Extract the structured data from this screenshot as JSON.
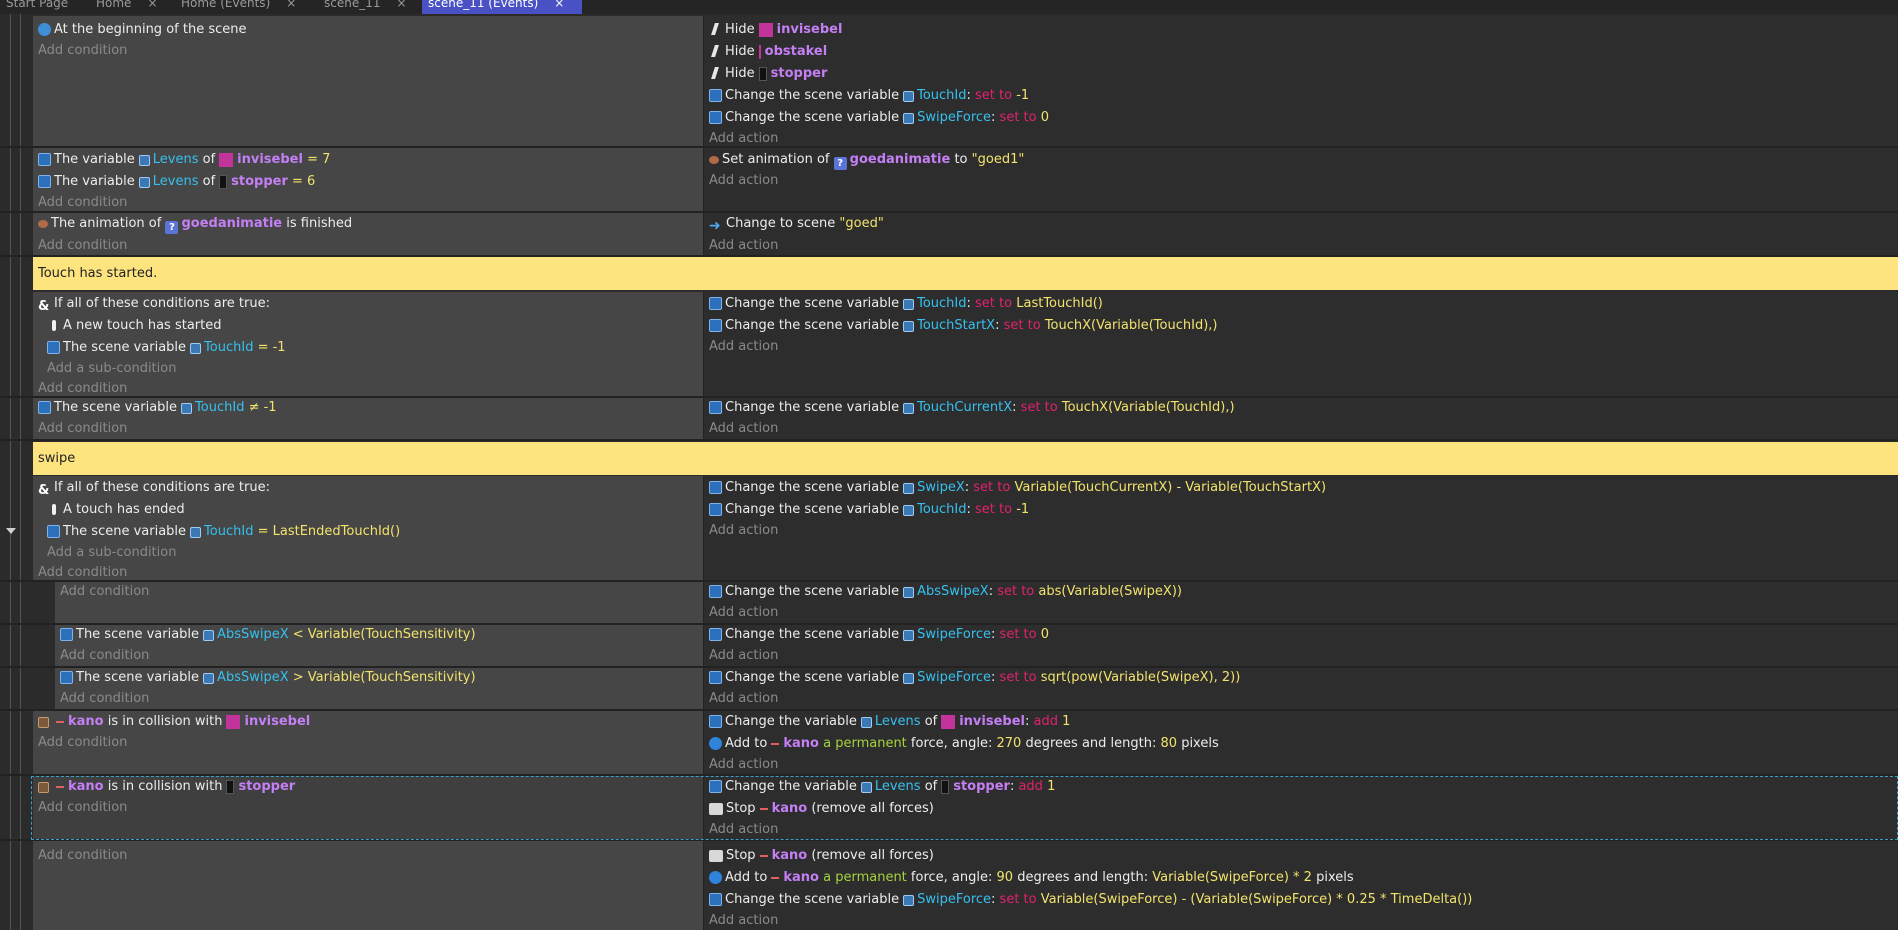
{
  "tabs": [
    {
      "label": "Start Page",
      "closable": false
    },
    {
      "label": "Home",
      "closable": true
    },
    {
      "label": "Home (Events)",
      "closable": true
    },
    {
      "label": "scene_11",
      "closable": true
    },
    {
      "label": "scene_11 (Events)",
      "closable": true,
      "active": true
    }
  ],
  "labels": {
    "add_condition": "Add condition",
    "add_action": "Add action",
    "add_subcondition": "Add a sub-condition"
  },
  "events": {
    "e1": {
      "cond": "At the beginning of the scene",
      "a1": {
        "verb": "Hide",
        "obj": "invisebel"
      },
      "a2": {
        "verb": "Hide",
        "obj": "obstakel"
      },
      "a3": {
        "verb": "Hide",
        "obj": "stopper"
      },
      "a4": {
        "text": "Change the scene variable",
        "var": "TouchId",
        "op": "set to",
        "val": "-1"
      },
      "a5": {
        "text": "Change the scene variable",
        "var": "SwipeForce",
        "op": "set to",
        "val": "0"
      }
    },
    "e2": {
      "c1": {
        "text": "The variable",
        "var": "Levens",
        "of": "of",
        "obj": "invisebel",
        "cmp": "= 7"
      },
      "c2": {
        "text": "The variable",
        "var": "Levens",
        "of": "of",
        "obj": "stopper",
        "cmp": "= 6"
      },
      "a1": {
        "text": "Set animation of",
        "obj": "goedanimatie",
        "to": "to",
        "val": "\"goed1\""
      }
    },
    "e3": {
      "c1": {
        "text": "The animation of",
        "obj": "goedanimatie",
        "tail": "is finished"
      },
      "a1": {
        "text": "Change to scene",
        "val": "\"goed\""
      }
    },
    "comment1": "Touch has started.",
    "e4": {
      "cond": "If all of these conditions are true:",
      "s1": "A new touch has started",
      "s2": {
        "text": "The scene variable",
        "var": "TouchId",
        "cmp": "= -1"
      },
      "a1": {
        "text": "Change the scene variable",
        "var": "TouchId",
        "op": "set to",
        "val": "LastTouchId()"
      },
      "a2": {
        "text": "Change the scene variable",
        "var": "TouchStartX",
        "op": "set to",
        "val": "TouchX(Variable(TouchId),)"
      }
    },
    "e5": {
      "c1": {
        "text": "The scene variable",
        "var": "TouchId",
        "cmp": "≠ -1"
      },
      "a1": {
        "text": "Change the scene variable",
        "var": "TouchCurrentX",
        "op": "set to",
        "val": "TouchX(Variable(TouchId),)"
      }
    },
    "comment2": "swipe",
    "e6": {
      "cond": "If all of these conditions are true:",
      "s1": "A touch has ended",
      "s2": {
        "text": "The scene variable",
        "var": "TouchId",
        "cmp": "= LastEndedTouchId()"
      },
      "a1": {
        "text": "Change the scene variable",
        "var": "SwipeX",
        "op": "set to",
        "val": "Variable(TouchCurrentX) - Variable(TouchStartX)"
      },
      "a2": {
        "text": "Change the scene variable",
        "var": "TouchId",
        "op": "set to",
        "val": "-1"
      }
    },
    "e7": {
      "a1": {
        "text": "Change the scene variable",
        "var": "AbsSwipeX",
        "op": "set to",
        "val": "abs(Variable(SwipeX))"
      }
    },
    "e8": {
      "c1": {
        "text": "The scene variable",
        "var": "AbsSwipeX",
        "cmp": "< Variable(TouchSensitivity)"
      },
      "a1": {
        "text": "Change the scene variable",
        "var": "SwipeForce",
        "op": "set to",
        "val": "0"
      }
    },
    "e9": {
      "c1": {
        "text": "The scene variable",
        "var": "AbsSwipeX",
        "cmp": "> Variable(TouchSensitivity)"
      },
      "a1": {
        "text": "Change the scene variable",
        "var": "SwipeForce",
        "op": "set to",
        "val": "sqrt(pow(Variable(SwipeX), 2))"
      }
    },
    "e10": {
      "c1": {
        "obj": "kano",
        "mid": "is in collision with",
        "obj2": "invisebel"
      },
      "a1": {
        "text": "Change the variable",
        "var": "Levens",
        "of": "of",
        "obj": "invisebel",
        "op": "add",
        "val": "1"
      },
      "a2": {
        "text": "Add to",
        "obj": "kano",
        "green": "a permanent",
        "mid": "force, angle:",
        "angle": "270",
        "mid2": "degrees and length:",
        "len": "80",
        "tail": "pixels"
      }
    },
    "e11": {
      "c1": {
        "obj": "kano",
        "mid": "is in collision with",
        "obj2": "stopper"
      },
      "a1": {
        "text": "Change the variable",
        "var": "Levens",
        "of": "of",
        "obj": "stopper",
        "op": "add",
        "val": "1"
      },
      "a2": {
        "text": "Stop",
        "obj": "kano",
        "tail": "(remove all forces)"
      }
    },
    "e12": {
      "a1": {
        "text": "Stop",
        "obj": "kano",
        "tail": "(remove all forces)"
      },
      "a2": {
        "text": "Add to",
        "obj": "kano",
        "green": "a permanent",
        "mid": "force, angle:",
        "angle": "90",
        "mid2": "degrees and length:",
        "len": "Variable(SwipeForce) * 2",
        "tail": "pixels"
      },
      "a3": {
        "text": "Change the scene variable",
        "var": "SwipeForce",
        "op": "set to",
        "val": "Variable(SwipeForce) - (Variable(SwipeForce) * 0.25 * TimeDelta())"
      }
    }
  }
}
